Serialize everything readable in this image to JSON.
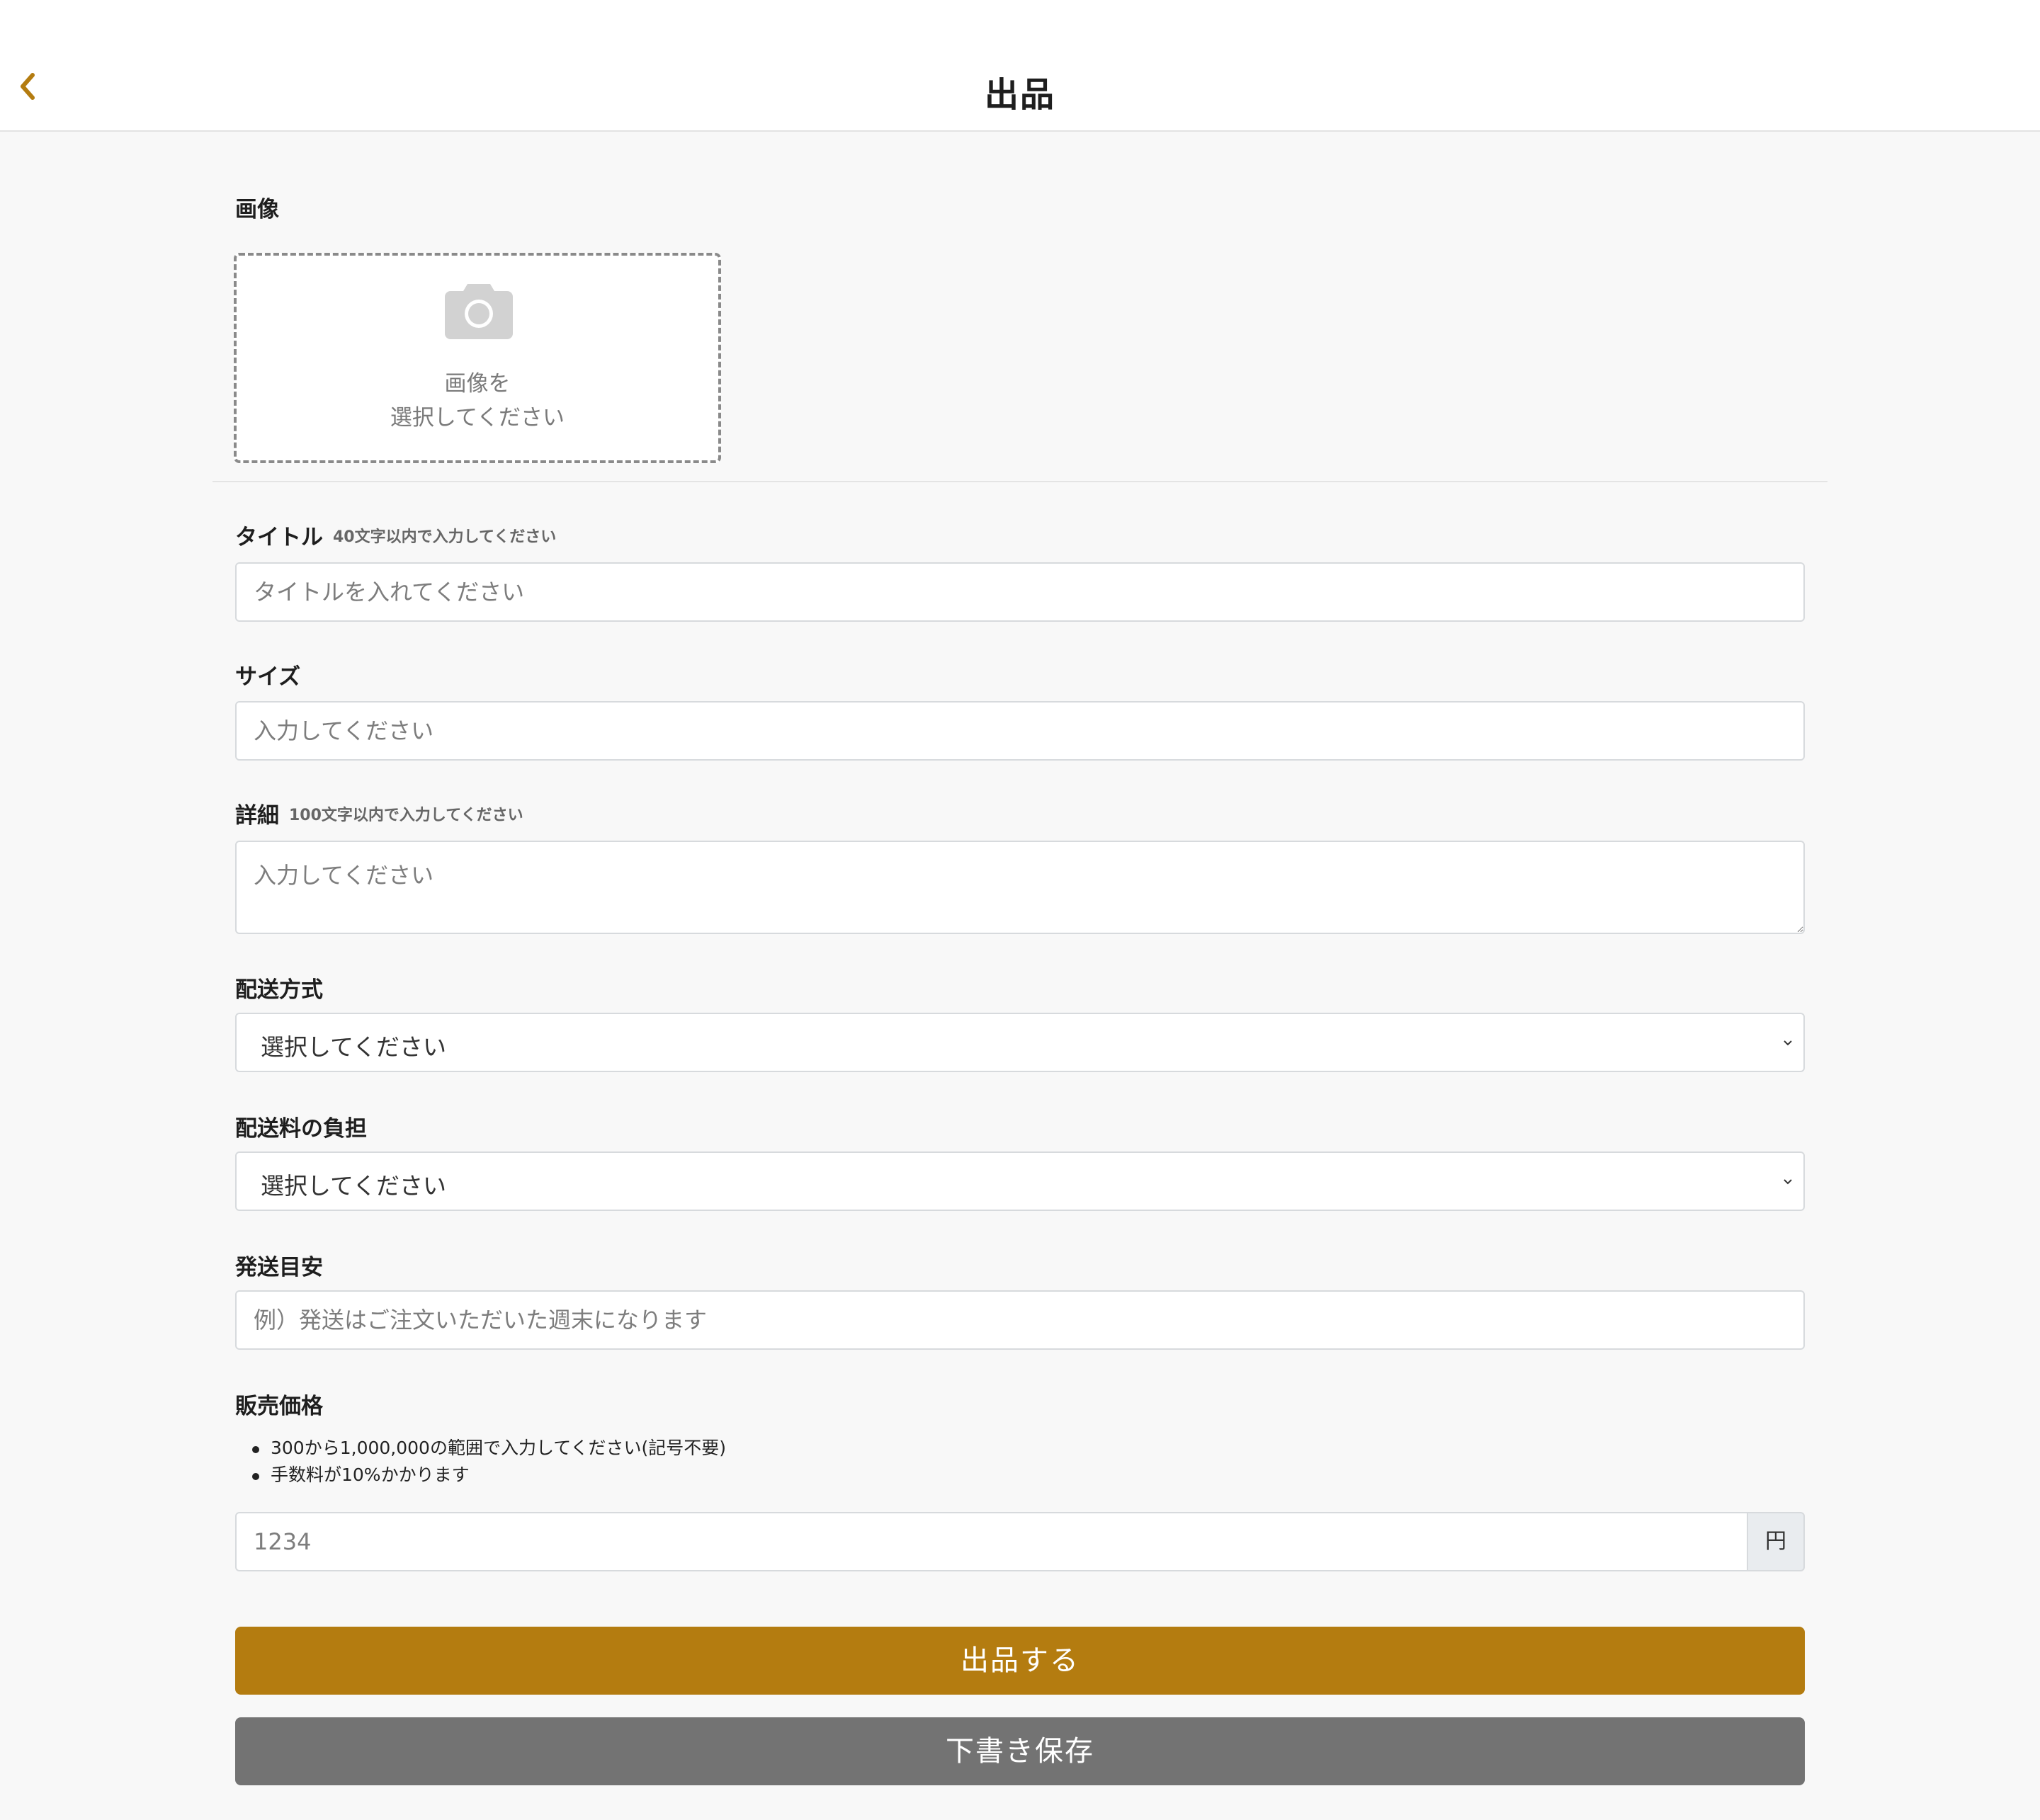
{
  "header": {
    "title": "出品"
  },
  "form": {
    "image": {
      "label": "画像",
      "prompt_line1": "画像を",
      "prompt_line2": "選択してください"
    },
    "title": {
      "label": "タイトル",
      "hint": "40文字以内で入力してください",
      "placeholder": "タイトルを入れてください",
      "value": ""
    },
    "size": {
      "label": "サイズ",
      "placeholder": "入力してください",
      "value": ""
    },
    "details": {
      "label": "詳細",
      "hint": "100文字以内で入力してください",
      "placeholder": "入力してください",
      "value": ""
    },
    "shipping_method": {
      "label": "配送方式",
      "selected": "選択してください"
    },
    "shipping_fee": {
      "label": "配送料の負担",
      "selected": "選択してください"
    },
    "shipping_estimate": {
      "label": "発送目安",
      "placeholder": "例）発送はご注文いただいた週末になります",
      "value": ""
    },
    "price": {
      "label": "販売価格",
      "notes": [
        "300から1,000,000の範囲で入力してください(記号不要)",
        "手数料が10%かかります"
      ],
      "placeholder": "1234",
      "value": "",
      "currency": "円"
    }
  },
  "actions": {
    "submit_label": "出品する",
    "draft_label": "下書き保存"
  },
  "colors": {
    "accent": "#b47c10",
    "secondary": "#737373",
    "back_icon": "#b47c10"
  },
  "icons": {
    "back": "chevron-left-icon",
    "image": "camera-icon",
    "select": "chevron-down-icon"
  }
}
